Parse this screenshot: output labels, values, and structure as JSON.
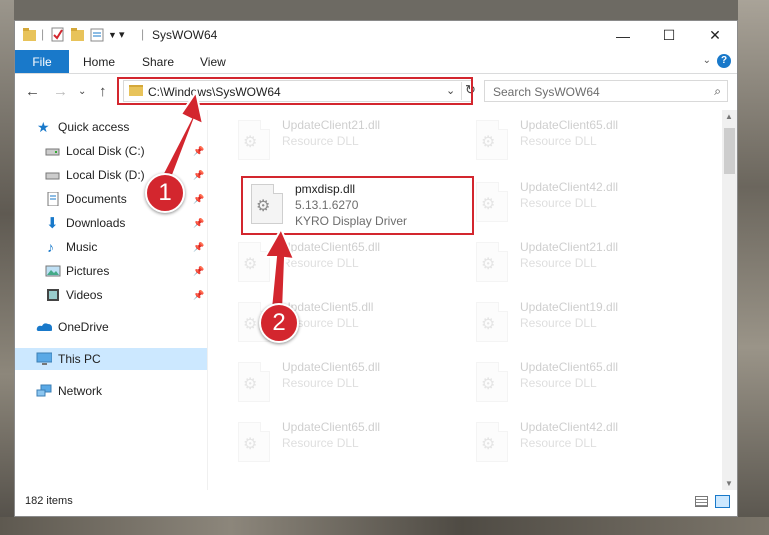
{
  "window": {
    "title": "SysWOW64",
    "controls": {
      "minimize": "—",
      "maximize": "☐",
      "close": "✕"
    }
  },
  "ribbon": {
    "tabs": [
      "File",
      "Home",
      "Share",
      "View"
    ],
    "help": "?"
  },
  "navbar": {
    "address": "C:\\Windows\\SysWOW64",
    "search_placeholder": "Search SysWOW64"
  },
  "sidebar": {
    "items": [
      {
        "label": "Quick access",
        "icon": "star-icon",
        "pinned": false
      },
      {
        "label": "Local Disk (C:)",
        "icon": "drive-icon",
        "pinned": true
      },
      {
        "label": "Local Disk (D:)",
        "icon": "drive-icon",
        "pinned": true
      },
      {
        "label": "Documents",
        "icon": "document-icon",
        "pinned": true
      },
      {
        "label": "Downloads",
        "icon": "download-icon",
        "pinned": true
      },
      {
        "label": "Music",
        "icon": "music-icon",
        "pinned": true
      },
      {
        "label": "Pictures",
        "icon": "pictures-icon",
        "pinned": true
      },
      {
        "label": "Videos",
        "icon": "videos-icon",
        "pinned": true
      },
      {
        "label": "OneDrive",
        "icon": "cloud-icon",
        "pinned": false
      },
      {
        "label": "This PC",
        "icon": "computer-icon",
        "pinned": false,
        "selected": true
      },
      {
        "label": "Network",
        "icon": "network-icon",
        "pinned": false
      }
    ]
  },
  "files": {
    "highlighted": {
      "name": "pmxdisp.dll",
      "version": "5.13.1.6270",
      "description": "KYRO Display Driver"
    },
    "faded": [
      {
        "name": "UpdateClient21.dll",
        "type": "Resource DLL"
      },
      {
        "name": "UpdateClient65.dll",
        "type": "Resource DLL"
      },
      {
        "name": "UpdateClient42.dll",
        "type": "Resource DLL"
      },
      {
        "name": "UpdateClient65.dll",
        "type": "Resource DLL"
      },
      {
        "name": "UpdateClient21.dll",
        "type": "Resource DLL"
      },
      {
        "name": "UpdateClient5.dll",
        "type": "Resource DLL"
      },
      {
        "name": "UpdateClient19.dll",
        "type": "Resource DLL"
      },
      {
        "name": "UpdateClient65.dll",
        "type": "Resource DLL"
      },
      {
        "name": "UpdateClient65.dll",
        "type": "Resource DLL"
      },
      {
        "name": "UpdateClient65.dll",
        "type": "Resource DLL"
      },
      {
        "name": "UpdateClient42.dll",
        "type": "Resource DLL"
      }
    ]
  },
  "status": {
    "item_count": "182 items"
  },
  "annotations": {
    "step1": "1",
    "step2": "2"
  },
  "colors": {
    "accent": "#1979ca",
    "highlight": "#d3262e",
    "selection": "#cce8ff"
  }
}
